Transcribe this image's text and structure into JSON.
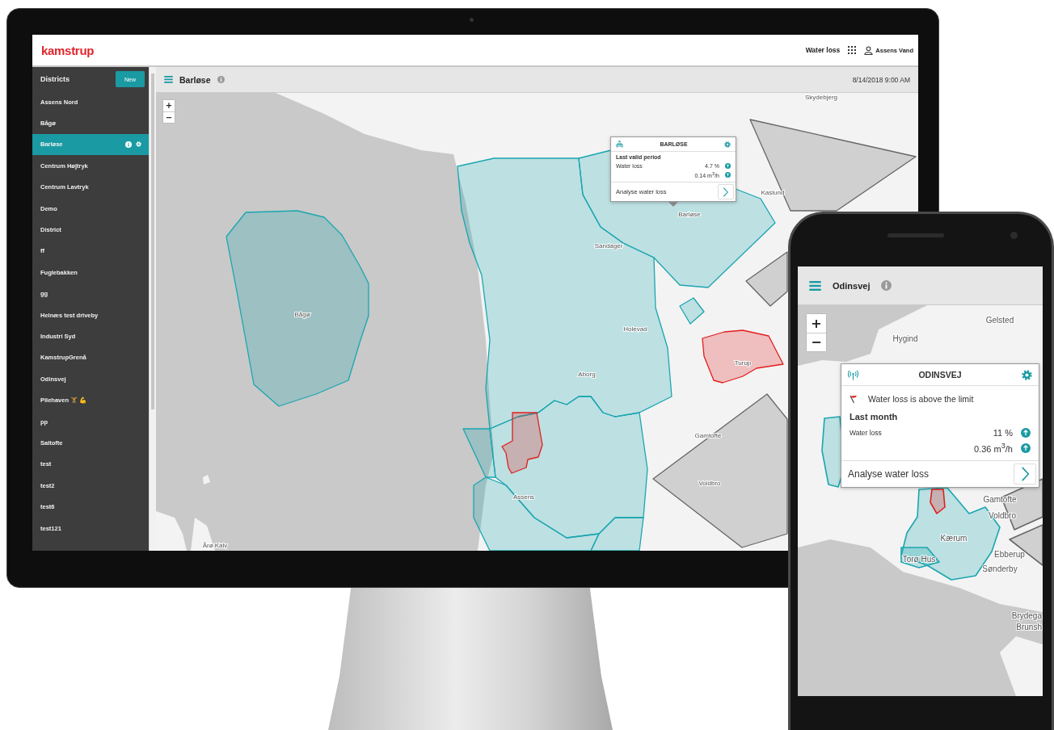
{
  "desktop": {
    "header": {
      "logo": "kamstrup",
      "app_name": "Water loss",
      "user": "Assens Vand"
    },
    "sidebar": {
      "title": "Districts",
      "new_button": "New",
      "items": [
        {
          "label": "Assens Nord",
          "selected": false
        },
        {
          "label": "Bågø",
          "selected": false
        },
        {
          "label": "Barløse",
          "selected": true
        },
        {
          "label": "Centrum Højtryk",
          "selected": false
        },
        {
          "label": "Centrum Lavtryk",
          "selected": false
        },
        {
          "label": "Demo",
          "selected": false
        },
        {
          "label": "District",
          "selected": false
        },
        {
          "label": "ff",
          "selected": false
        },
        {
          "label": "Fuglebakken",
          "selected": false
        },
        {
          "label": "gg",
          "selected": false
        },
        {
          "label": "Helnæs test driveby",
          "selected": false
        },
        {
          "label": "Industri Syd",
          "selected": false
        },
        {
          "label": "KamstrupGrenå",
          "selected": false
        },
        {
          "label": "Odinsvej",
          "selected": false
        },
        {
          "label": "Pilehaven 🏋 💪",
          "selected": false
        },
        {
          "label": "pp",
          "selected": false
        },
        {
          "label": "Saltofte",
          "selected": false
        },
        {
          "label": "test",
          "selected": false
        },
        {
          "label": "test2",
          "selected": false
        },
        {
          "label": "test6",
          "selected": false
        },
        {
          "label": "test121",
          "selected": false
        }
      ]
    },
    "toolbar": {
      "title": "Barløse",
      "date": "8/14/2018 9:00 AM"
    },
    "map": {
      "zoom_in": "+",
      "zoom_out": "−",
      "zones": [
        {
          "color": "#1aa6b0"
        },
        {
          "color": "#1aa6b0"
        },
        {
          "color": "#1aa6b0"
        },
        {
          "color": "#1aa6b0"
        },
        {
          "color": "#1aa6b0"
        },
        {
          "color": "#1aa6b0"
        },
        {
          "color": "#1aa6b0"
        },
        {
          "color": "#1aa6b0"
        },
        {
          "color": "#e31e1e"
        },
        {
          "color": "#e31e1e"
        },
        {
          "color": "#666666"
        },
        {
          "color": "#666666"
        },
        {
          "color": "#666666"
        }
      ],
      "labels": [
        "Skydebjerg",
        "Kaslund",
        "Barløse",
        "Sandager",
        "Holevad",
        "Aborg",
        "Turup",
        "Gamtofte",
        "Voldbro",
        "Assens",
        "Bågø",
        "Årø Kalv"
      ]
    },
    "popup": {
      "title": "BARLØSE",
      "section": "Last valid period",
      "metric": "Water loss",
      "values": [
        "4.7 %",
        "0.14 m$^{3}$/h"
      ],
      "action": "Analyse water loss"
    }
  },
  "phone": {
    "toolbar": {
      "title": "Odinsvej"
    },
    "map": {
      "zoom_in": "+",
      "zoom_out": "−",
      "zones": [
        {
          "color": "#1aa6b0"
        },
        {
          "color": "#1aa6b0"
        },
        {
          "color": "#1aa6b0"
        },
        {
          "color": "#e31e1e"
        },
        {
          "color": "#666666"
        },
        {
          "color": "#666666"
        }
      ],
      "labels": [
        "Gelsted",
        "Hygind",
        "Gamtofte",
        "Voldbro",
        "Kærum",
        "Ebberup",
        "Sønderby",
        "Torø Hus",
        "Brydega",
        "Brunsh"
      ]
    },
    "popup": {
      "title": "ODINSVEJ",
      "alert": "Water loss is above the limit",
      "section": "Last month",
      "metric": "Water loss",
      "values": [
        "11 %",
        "0.36 m$^{3}$/h"
      ],
      "action": "Analyse water loss"
    }
  }
}
